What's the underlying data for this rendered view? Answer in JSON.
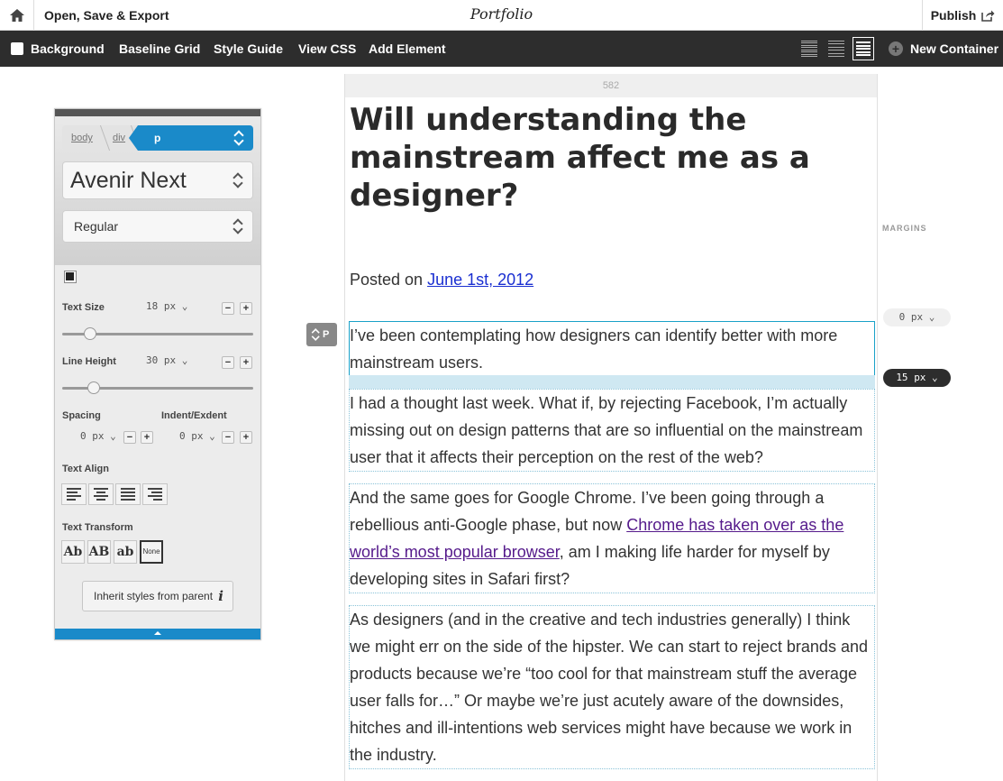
{
  "topbar": {
    "open_save": "Open, Save & Export",
    "title": "Portfolio",
    "publish": "Publish"
  },
  "toolbar": {
    "background": "Background",
    "baseline_grid": "Baseline Grid",
    "style_guide": "Style Guide",
    "view_css": "View CSS",
    "add_element": "Add Element",
    "new_container": "New Container"
  },
  "panel": {
    "breadcrumb": [
      "body",
      "div",
      "p"
    ],
    "font_family": "Avenir Next",
    "font_weight": "Regular",
    "text_size_label": "Text Size",
    "text_size_value": "18",
    "text_size_unit": "px",
    "text_size_slider": 0.12,
    "line_height_label": "Line Height",
    "line_height_value": "30",
    "line_height_unit": "px",
    "line_height_slider": 0.14,
    "spacing_label": "Spacing",
    "spacing_value": "0",
    "spacing_unit": "px",
    "indent_label": "Indent/Exdent",
    "indent_value": "0",
    "indent_unit": "px",
    "text_align_label": "Text Align",
    "text_transform_label": "Text Transform",
    "transforms": [
      "Ab",
      "AB",
      "ab",
      "None"
    ],
    "inherit_label": "Inherit styles from parent",
    "minus": "−",
    "plus": "+"
  },
  "canvas": {
    "width_readout": "582",
    "headline": "Will understanding the mainstream affect me as a designer?",
    "posted_prefix": "Posted on ",
    "posted_date": "June 1st, 2012",
    "p_tag": "P",
    "paragraphs": {
      "p1": "I’ve been contemplating how designers can identify better with more mainstream users.",
      "p2": "I had a thought last week. What if, by rejecting Facebook, I’m actually missing out on design patterns that are so influential on the mainstream user that it affects their perception on the rest of the web?",
      "p3_before": "And the same goes for Google Chrome. I’ve been going through a rebellious anti-Google phase, but now ",
      "p3_link": "Chrome has taken over as the world’s most popular browser",
      "p3_after": ", am I making life harder for myself by developing sites in Safari first?",
      "p4": "As designers (and in the creative and tech industries generally) I think we might err on the side of the hipster. We can start to reject brands and products because we’re “too cool for that mainstream stuff the average user falls for…” Or maybe we’re just acutely aware of the downsides, hitches and ill-intentions web services might have because we work in the industry."
    }
  },
  "margins": {
    "label": "MARGINS",
    "top_value": "0",
    "bottom_value": "15",
    "unit": "px"
  },
  "colors": {
    "accent": "#1a8ac9",
    "toolbar": "#2d2d2d",
    "link": "#1a2fd1",
    "visited_link": "#551a8b"
  }
}
